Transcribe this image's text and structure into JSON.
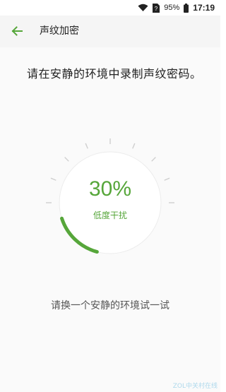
{
  "status_bar": {
    "battery_percent": "95%",
    "time": "17:19",
    "icons": [
      "wifi-icon",
      "sim-unknown-icon",
      "battery-icon"
    ]
  },
  "toolbar": {
    "back_icon": "arrow-left-icon",
    "title": "声纹加密"
  },
  "main": {
    "instruction": "请在安静的环境中录制声纹密码。",
    "meter": {
      "percent_text": "30%",
      "level": 0.3,
      "status": "低度干扰"
    },
    "hint": "请换一个安静的环境试一试"
  },
  "watermark": "ZOL中关村在线",
  "colors": {
    "accent": "#56a63a",
    "tick": "#cfcfcf",
    "ring_bg": "#ececec",
    "toolbar_bg": "#f5f5f5",
    "page_bg": "#fafafa"
  }
}
